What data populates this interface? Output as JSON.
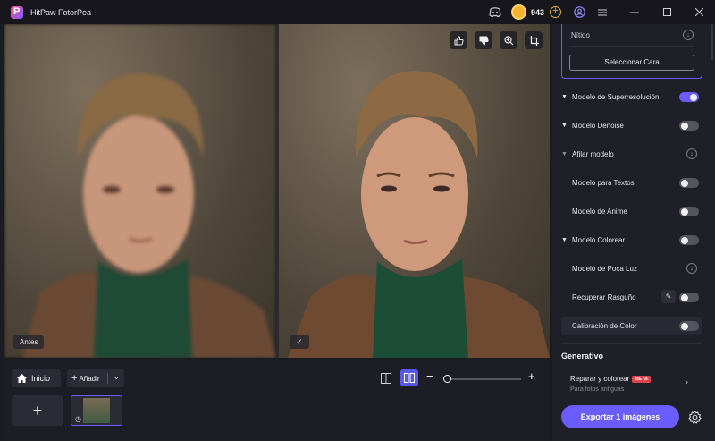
{
  "app": {
    "title": "HitPaw FotorPea"
  },
  "header": {
    "coins": "943"
  },
  "preview": {
    "before_label": "Antes"
  },
  "bottom": {
    "home_label": "Inicio",
    "add_label": "Añadir",
    "add_tile": "+"
  },
  "panel": {
    "top_card": {
      "value": "Nítido",
      "face_button": "Seleccionar Cara"
    },
    "rows": [
      {
        "label": "Modelo de Superresolución",
        "on": true
      },
      {
        "label": "Modelo Denoise",
        "on": false
      },
      {
        "label": "Afilar modelo"
      },
      {
        "label": "Modelo para Textos",
        "on": false
      },
      {
        "label": "Modelo de Anime",
        "on": false
      },
      {
        "label": "Modelo Colorear",
        "on": false
      },
      {
        "label": "Modelo de Poca Luz"
      },
      {
        "label": "Recuperar Rasguño",
        "on": false
      },
      {
        "label": "Calibración de Color",
        "on": false
      }
    ],
    "generative": {
      "title": "Generativo",
      "item_label": "Reparar y colorear",
      "beta": "BETA",
      "item_sub": "Para fotos antiguas"
    },
    "export_label": "Exportar 1 imágenes"
  },
  "zoom": {
    "level": 0.05
  },
  "colors": {
    "accent": "#6a5cff",
    "coin": "#f4b32c",
    "beta": "#e2464d"
  },
  "icons": [
    "discord-icon",
    "coin-icon",
    "add-coin-icon",
    "account-icon",
    "menu-icon",
    "minimize-icon",
    "maximize-icon",
    "close-icon",
    "thumbs-up-icon",
    "thumbs-down-icon",
    "zoom-in-icon",
    "crop-icon",
    "home-icon",
    "chevron-down-icon",
    "split-view-icon",
    "side-by-side-icon",
    "gear-icon"
  ]
}
